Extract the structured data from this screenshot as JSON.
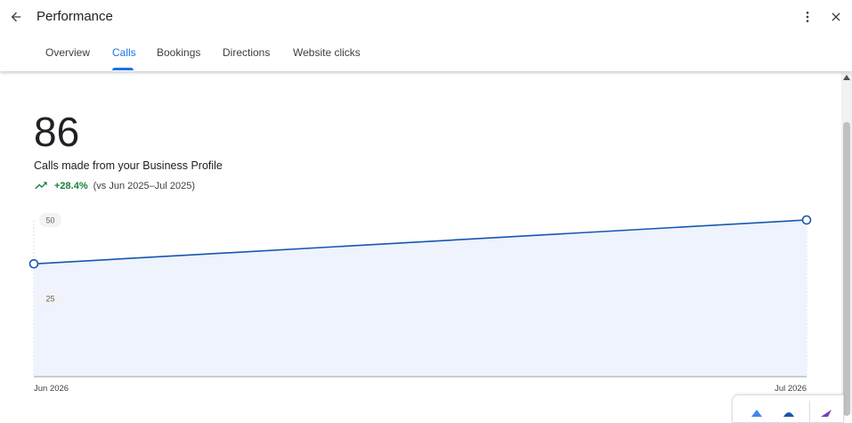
{
  "header": {
    "title": "Performance",
    "icons": {
      "back": "arrow-back-icon",
      "more": "more-vert-icon",
      "close": "close-icon"
    }
  },
  "tabs": [
    {
      "label": "Overview",
      "active": false
    },
    {
      "label": "Calls",
      "active": true
    },
    {
      "label": "Bookings",
      "active": false
    },
    {
      "label": "Directions",
      "active": false
    },
    {
      "label": "Website clicks",
      "active": false
    }
  ],
  "metric": {
    "value": "86",
    "label": "Calls made from your Business Profile",
    "trend_percent": "+28.4%",
    "trend_compare": "(vs Jun 2025–Jul 2025)",
    "trend_icon": "trending-up-icon"
  },
  "chart_data": {
    "type": "area",
    "x": [
      "Jun 2026",
      "Jul 2026"
    ],
    "series": [
      {
        "values": [
          36,
          50
        ]
      }
    ],
    "yticks": [
      "50",
      "25"
    ],
    "ylim": [
      0,
      50
    ],
    "grid": false
  },
  "colors": {
    "accent": "#1a73e8",
    "line": "#1557b0",
    "area_fill": "#eef3fd",
    "positive": "#188038",
    "text": "#202124"
  }
}
